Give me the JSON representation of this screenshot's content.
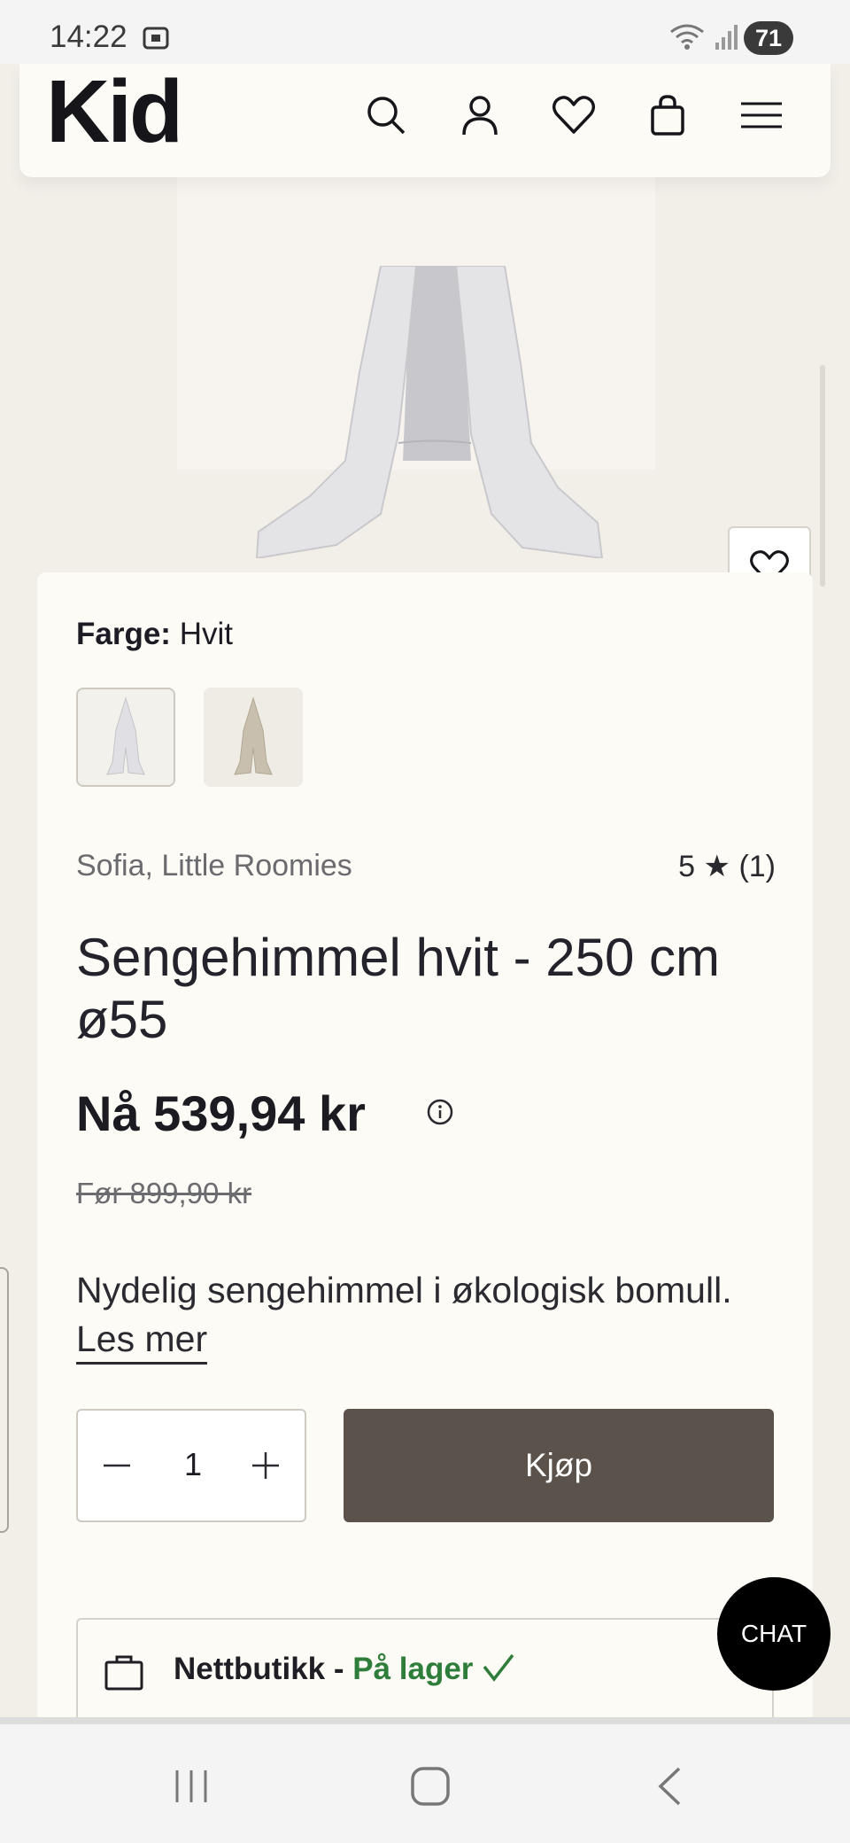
{
  "status_bar": {
    "time": "14:22",
    "battery": "71",
    "icons": [
      "screenshot-icon",
      "wifi-icon",
      "signal-icon"
    ]
  },
  "header": {
    "logo": "Kid",
    "icons": [
      "search-icon",
      "account-icon",
      "wishlist-icon",
      "cart-icon",
      "menu-icon"
    ]
  },
  "product": {
    "color_label": "Farge:",
    "color_value": "Hvit",
    "swatches": [
      "Hvit",
      "Beige"
    ],
    "brand": "Sofia, Little Roomies",
    "rating": "5 ★ (1)",
    "title": "Sengehimmel hvit - 250 cm ø55",
    "price": "Nå 539,94 kr",
    "old_price": "Før 899,90 kr",
    "description": "Nydelig sengehimmel i økologisk bomull.",
    "read_more": "Les mer",
    "quantity": "1",
    "buy_label": "Kjøp"
  },
  "stock": {
    "channel": "Nettbutikk -",
    "status": "På lager",
    "status_color": "#2f7d3b"
  },
  "chat_label": "CHAT",
  "colors": {
    "background": "#f2efe9",
    "card": "#fcfbf6",
    "buy_button": "#5a524b"
  }
}
